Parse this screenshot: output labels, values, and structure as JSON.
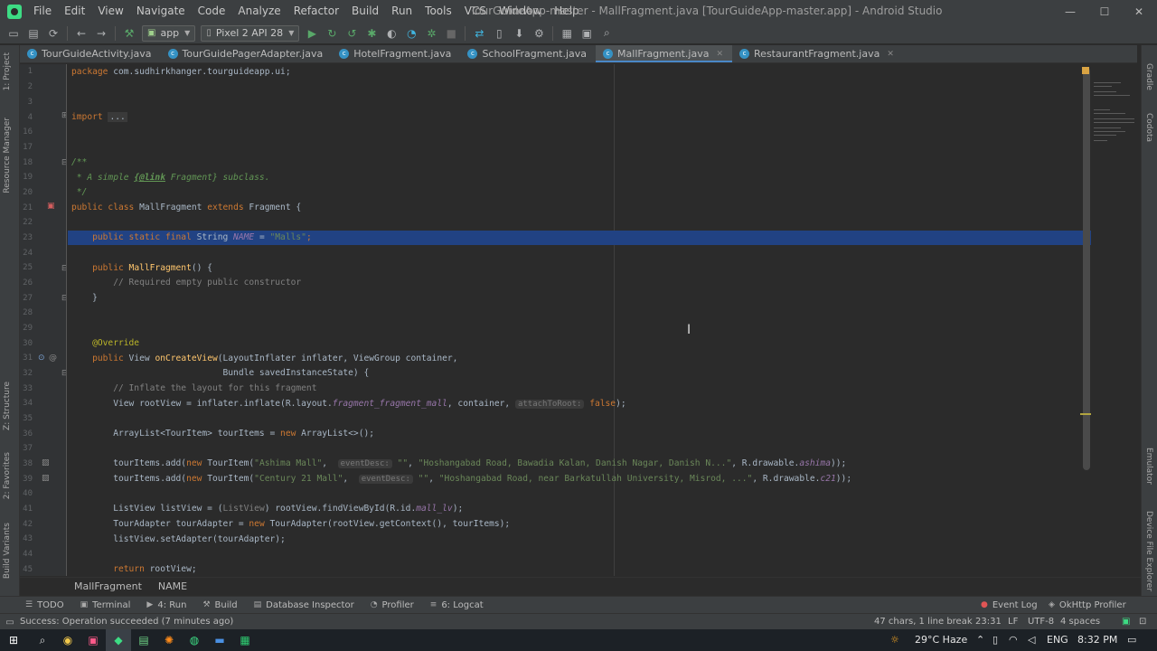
{
  "window": {
    "title": "TourGuideApp-master - MallFragment.java [TourGuideApp-master.app] - Android Studio",
    "minimize": "—",
    "maximize": "☐",
    "close": "✕"
  },
  "menu": [
    "File",
    "Edit",
    "View",
    "Navigate",
    "Code",
    "Analyze",
    "Refactor",
    "Build",
    "Run",
    "Tools",
    "VCS",
    "Window",
    "Help"
  ],
  "toolbar": {
    "module_combo": "app",
    "device_combo": "Pixel 2 API 28"
  },
  "tabs": [
    {
      "label": "TourGuideActivity.java",
      "active": false
    },
    {
      "label": "TourGuidePagerAdapter.java",
      "active": false
    },
    {
      "label": "HotelFragment.java",
      "active": false
    },
    {
      "label": "SchoolFragment.java",
      "active": false
    },
    {
      "label": "MallFragment.java",
      "active": true
    },
    {
      "label": "RestaurantFragment.java",
      "active": false
    }
  ],
  "left_tools": [
    "1: Project",
    "Resource Manager",
    "Z: Structure",
    "2: Favorites",
    "Build Variants"
  ],
  "right_tools": [
    "Gradle",
    "Codota",
    "Emulator",
    "Device File Explorer"
  ],
  "editor": {
    "line_numbers": [
      "1",
      "2",
      "3",
      "4",
      "16",
      "17",
      "18",
      "19",
      "20",
      "21",
      "22",
      "23",
      "24",
      "25",
      "26",
      "27",
      "28",
      "29",
      "30",
      "31",
      "32",
      "33",
      "34",
      "35",
      "36",
      "37",
      "38",
      "39",
      "40",
      "41",
      "42",
      "43",
      "44",
      "45"
    ],
    "lines": {
      "l1_kw": "package ",
      "l1_pkg": "com.sudhirkhanger.tourguideapp.ui;",
      "l4_kw": "import ",
      "l4_fold": "...",
      "l18": "/**",
      "l19_a": " * A simple ",
      "l19_tag": "{@link",
      "l19_b": " Fragment} subclass.",
      "l20": " */",
      "l21_kw": "public class ",
      "l21_name": "MallFragment ",
      "l21_ext": "extends ",
      "l21_rest": "Fragment {",
      "l23_kw": "    public static final ",
      "l23_type": "String",
      "l23_field": " NAME",
      "l23_eq": " = ",
      "l23_str": "\"Malls\"",
      "l23_end": ";",
      "l25_kw": "    public ",
      "l25_fn": "MallFragment",
      "l25_rest": "() {",
      "l26": "        // Required empty public constructor",
      "l27": "    }",
      "l30": "    @Override",
      "l31_kw": "    public ",
      "l31_type": "View ",
      "l31_fn": "onCreateView",
      "l31_rest": "(LayoutInflater inflater, ViewGroup container,",
      "l32": "                             Bundle savedInstanceState) {",
      "l33": "        // Inflate the layout for this fragment",
      "l34_a": "        View rootView = inflater.inflate(R.layout.",
      "l34_fld": "fragment_fragment_mall",
      "l34_b": ", container, ",
      "l34_hint": "attachToRoot:",
      "l34_kw": " false",
      "l34_end": ");",
      "l36_a": "        ArrayList<TourItem> tourItems = ",
      "l36_kw": "new ",
      "l36_b": "ArrayList<>();",
      "l38_a": "        tourItems.add(",
      "l38_kw": "new ",
      "l38_b": "TourItem(",
      "l38_s1": "\"Ashima Mall\"",
      "l38_c": ",  ",
      "l38_hint": "eventDesc:",
      "l38_s2": " \"\"",
      "l38_d": ", ",
      "l38_s3": "\"Hoshangabad Road, Bawadia Kalan, Danish Nagar, Danish N...\"",
      "l38_e": ", R.drawable.",
      "l38_fld": "ashima",
      "l38_end": "));",
      "l39_a": "        tourItems.add(",
      "l39_kw": "new ",
      "l39_b": "TourItem(",
      "l39_s1": "\"Century 21 Mall\"",
      "l39_c": ",  ",
      "l39_hint": "eventDesc:",
      "l39_s2": " \"\"",
      "l39_d": ", ",
      "l39_s3": "\"Hoshangabad Road, near Barkatullah University, Misrod, ...\"",
      "l39_e": ", R.drawable.",
      "l39_fld": "c21",
      "l39_end": "));",
      "l41_a": "        ListView listView = (",
      "l41_cast": "ListView",
      "l41_b": ") rootView.findViewById(R.id.",
      "l41_fld": "mall_lv",
      "l41_end": ");",
      "l42_a": "        TourAdapter tourAdapter = ",
      "l42_kw": "new ",
      "l42_b": "TourAdapter(rootView.getContext(), tourItems);",
      "l43": "        listView.setAdapter(tourAdapter);",
      "l45_kw": "        return ",
      "l45_b": "rootView;"
    }
  },
  "breadcrumb": {
    "class": "MallFragment",
    "member": "NAME"
  },
  "bottom_tools": [
    {
      "label": "TODO",
      "icon": "list-icon"
    },
    {
      "label": "Terminal",
      "icon": "terminal-icon"
    },
    {
      "label": "4: Run",
      "icon": "run-icon"
    },
    {
      "label": "Build",
      "icon": "hammer-icon"
    },
    {
      "label": "Database Inspector",
      "icon": "database-icon"
    },
    {
      "label": "Profiler",
      "icon": "profiler-icon"
    },
    {
      "label": "6: Logcat",
      "icon": "logcat-icon"
    }
  ],
  "bottom_right_tools": [
    {
      "label": "Event Log",
      "icon": "event-log-icon"
    },
    {
      "label": "OkHttp Profiler",
      "icon": "okhttp-icon"
    }
  ],
  "status": {
    "message": "Success: Operation succeeded (7 minutes ago)",
    "selection": "47 chars, 1 line break",
    "position": "23:31",
    "line_sep": "LF",
    "encoding": "UTF-8",
    "indent": "4 spaces"
  },
  "taskbar": {
    "weather": "29°C  Haze",
    "lang": "ENG",
    "time": "8:32 PM"
  },
  "colors": {
    "editor_bg": "#2b2b2b",
    "selection": "#214283",
    "keyword": "#cc7832",
    "string": "#6a8759",
    "accent": "#4a88c7"
  }
}
